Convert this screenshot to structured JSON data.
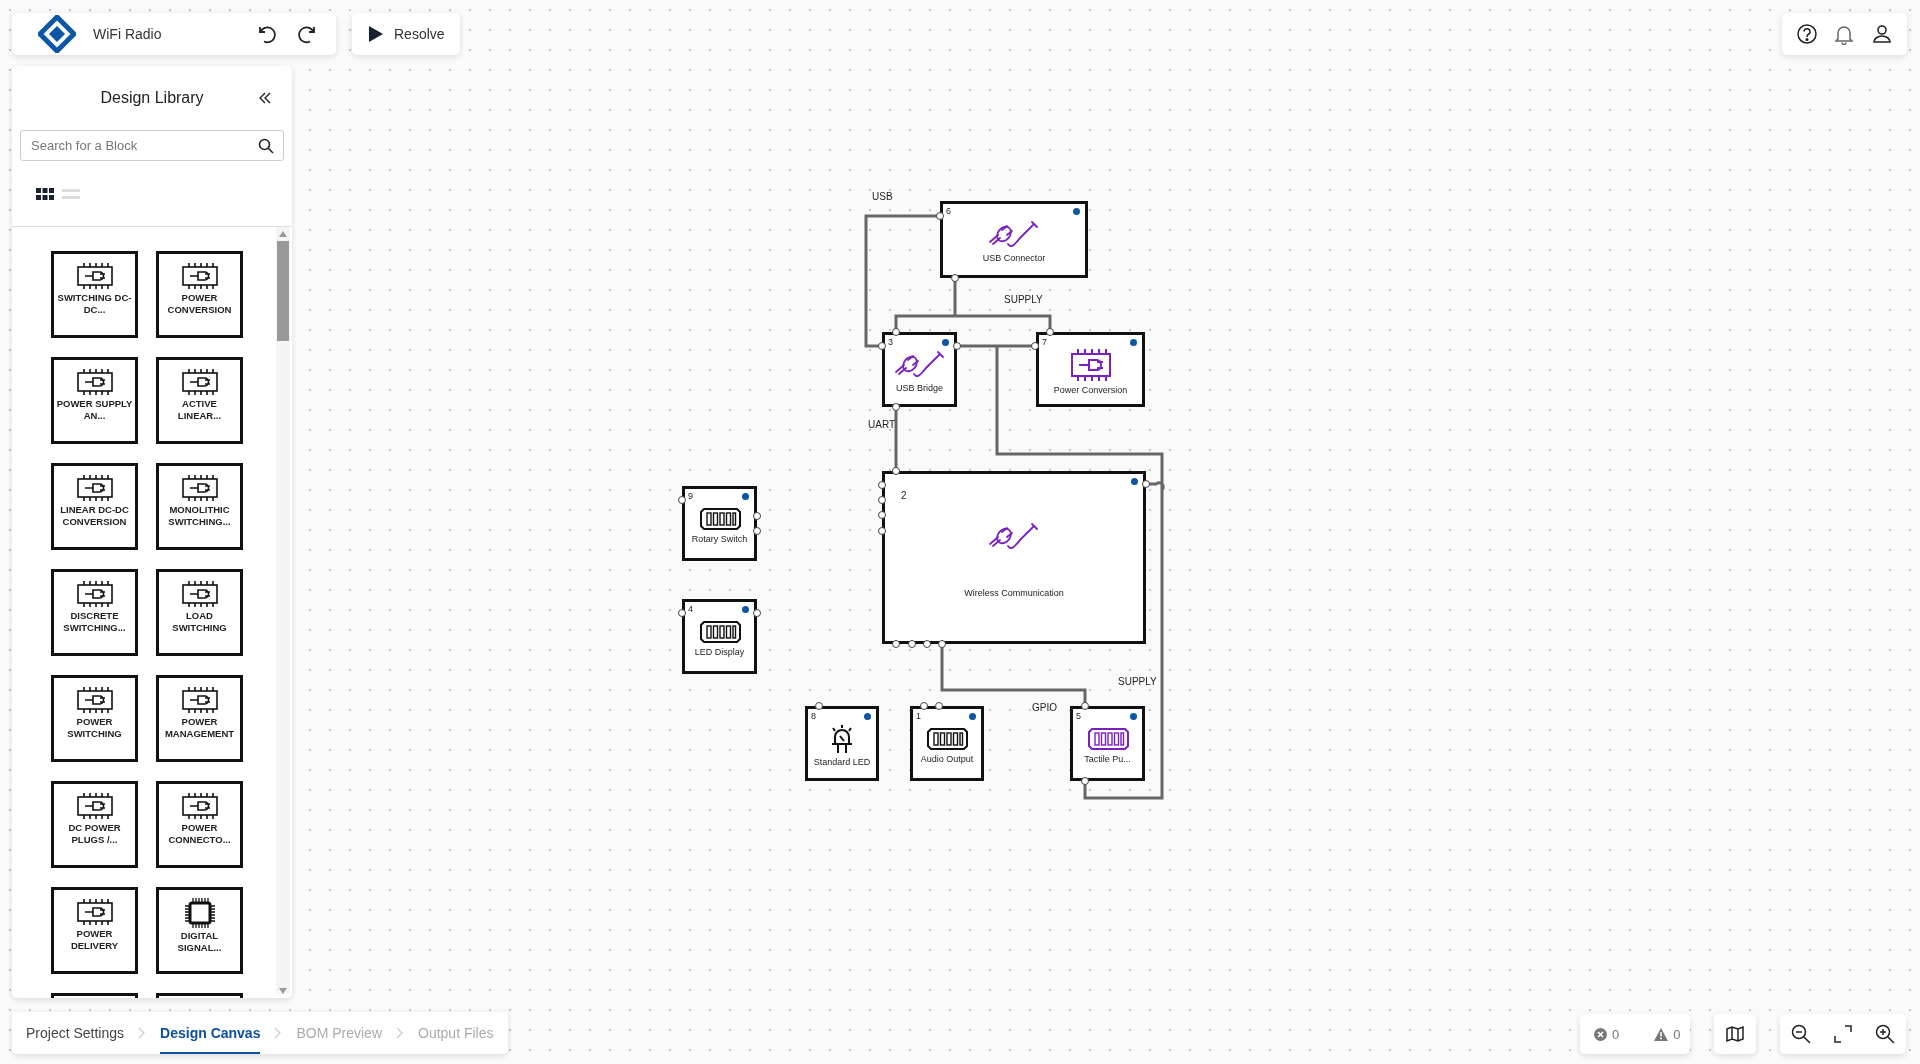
{
  "app": {
    "project_title": "WiFi Radio",
    "resolve_label": "Resolve"
  },
  "library": {
    "title": "Design Library",
    "search": {
      "placeholder": "Search for a Block"
    },
    "view_modes": [
      {
        "kind": "grid",
        "selected": true
      },
      {
        "kind": "list",
        "selected": false
      }
    ],
    "blocks": [
      {
        "label": "SWITCHING DC-DC...",
        "kind": "ic"
      },
      {
        "label": "POWER CONVERSION",
        "kind": "ic"
      },
      {
        "label": "POWER SUPPLY AN...",
        "kind": "ic"
      },
      {
        "label": "ACTIVE LINEAR...",
        "kind": "ic"
      },
      {
        "label": "LINEAR DC-DC CONVERSION",
        "kind": "ic"
      },
      {
        "label": "MONOLITHIC SWITCHING...",
        "kind": "ic"
      },
      {
        "label": "DISCRETE SWITCHING...",
        "kind": "ic"
      },
      {
        "label": "LOAD SWITCHING",
        "kind": "ic"
      },
      {
        "label": "POWER SWITCHING",
        "kind": "ic"
      },
      {
        "label": "POWER MANAGEMENT",
        "kind": "ic"
      },
      {
        "label": "DC POWER PLUGS /...",
        "kind": "ic"
      },
      {
        "label": "POWER CONNECTO...",
        "kind": "ic"
      },
      {
        "label": "POWER DELIVERY",
        "kind": "ic"
      },
      {
        "label": "DIGITAL SIGNAL...",
        "kind": "processor"
      },
      {
        "kind": "cut"
      },
      {
        "kind": "cut"
      }
    ]
  },
  "canvas": {
    "nodes": [
      {
        "number": "6",
        "label": "USB Connector",
        "kind": "cable",
        "accent": true
      },
      {
        "number": "3",
        "label": "USB Bridge",
        "kind": "cable",
        "accent": true
      },
      {
        "number": "7",
        "label": "Power Conversion",
        "kind": "chip",
        "accent": true
      },
      {
        "number": "9",
        "label": "Rotary Switch",
        "kind": "dip",
        "accent": false
      },
      {
        "number": "2",
        "label": "Wireless Communication",
        "kind": "cable",
        "accent": true
      },
      {
        "number": "4",
        "label": "LED Display",
        "kind": "dip",
        "accent": false
      },
      {
        "number": "8",
        "label": "Standard LED",
        "kind": "led",
        "accent": false
      },
      {
        "number": "1",
        "label": "Audio Output",
        "kind": "dip",
        "accent": false
      },
      {
        "number": "5",
        "label": "Tactile Pu...",
        "kind": "dip",
        "accent": true
      }
    ],
    "connections": [
      {
        "label": "USB"
      },
      {
        "label": "SUPPLY"
      },
      {
        "label": "UART"
      },
      {
        "label": "GPIO"
      },
      {
        "label": "SUPPLY"
      }
    ]
  },
  "steps": [
    {
      "label": "Project Settings",
      "selected": false,
      "completed": true
    },
    {
      "label": "Design Canvas",
      "selected": true,
      "completed": false
    },
    {
      "label": "BOM Preview",
      "selected": false,
      "completed": false
    },
    {
      "label": "Output Files",
      "selected": false,
      "completed": false
    }
  ],
  "status": {
    "errors": "0",
    "warnings": "0"
  }
}
